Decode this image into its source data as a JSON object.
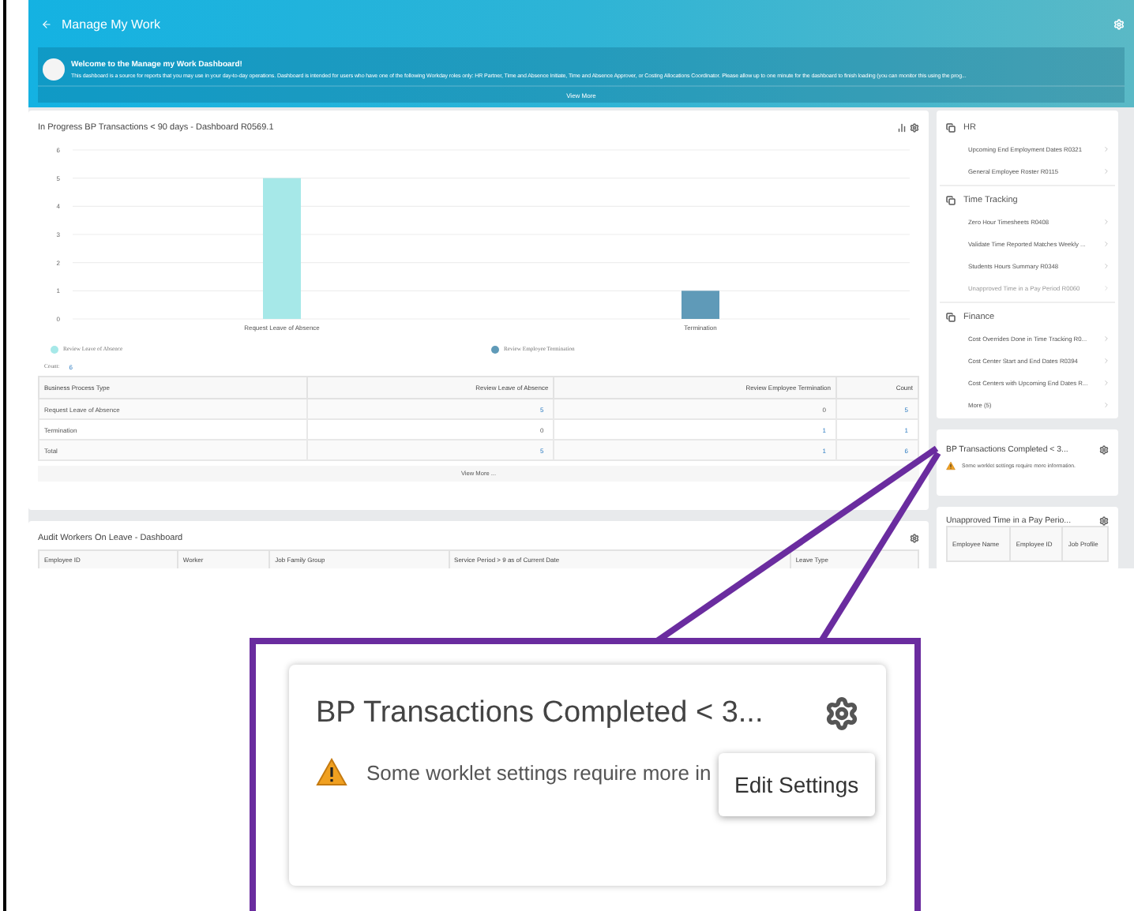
{
  "header": {
    "title": "Manage My Work"
  },
  "welcome": {
    "title": "Welcome to the Manage my Work Dashboard!",
    "text": "This dashboard is a source for reports that you may use in your day-to-day operations. Dashboard is intended for users who have one of the following Workday roles only: HR Partner, Time and Absence Initiate, Time and Absence Approver, or Costing Allocations Coordinator. Please allow up to one minute for the dashboard to finish loading (you can monitor this using the prog...",
    "action": "View More"
  },
  "chart_card": {
    "title": "In Progress BP Transactions < 90 days - Dashboard R0569.1",
    "chart_data": {
      "type": "bar",
      "categories": [
        "Request Leave of Absence",
        "Termination"
      ],
      "series": [
        {
          "name": "Review Leave of Absence",
          "color": "#a6e8e8",
          "values": [
            5,
            0
          ]
        },
        {
          "name": "Review Employee Termination",
          "color": "#5f9ab8",
          "values": [
            0,
            1
          ]
        }
      ],
      "ylim": [
        0,
        6
      ],
      "grid": true,
      "yticks": [
        0,
        1,
        2,
        3,
        4,
        5,
        6
      ]
    },
    "count_label": "Count:",
    "count": "6",
    "table": {
      "columns": [
        "Business Process Type",
        "Review Leave of Absence",
        "Review Employee Termination",
        "Count"
      ],
      "rows": [
        [
          {
            "text": "Request Leave of Absence",
            "link": false
          },
          {
            "text": "5",
            "link": true
          },
          {
            "text": "0",
            "link": false
          },
          {
            "text": "5",
            "link": true
          }
        ],
        [
          {
            "text": "Termination",
            "link": false
          },
          {
            "text": "0",
            "link": false
          },
          {
            "text": "1",
            "link": true
          },
          {
            "text": "1",
            "link": true
          }
        ],
        [
          {
            "text": "Total",
            "link": false
          },
          {
            "text": "5",
            "link": true
          },
          {
            "text": "1",
            "link": true
          },
          {
            "text": "6",
            "link": true
          }
        ]
      ]
    },
    "view_more": "View More ..."
  },
  "audit_card": {
    "title": "Audit Workers On Leave - Dashboard",
    "columns": [
      "Employee ID",
      "Worker",
      "Job Family Group",
      "Service Period > 9 as of Current Date",
      "Leave Type"
    ]
  },
  "nav": {
    "sections": [
      {
        "title": "HR",
        "items": [
          "Upcoming End Employment Dates R0321",
          "General Employee Roster R0115"
        ]
      },
      {
        "title": "Time Tracking",
        "items": [
          "Zero Hour Timesheets R0408",
          "Validate Time Reported Matches Weekly ...",
          "Students Hours Summary R0348",
          "Unapproved Time in a Pay Period R0060"
        ]
      },
      {
        "title": "Finance",
        "items": [
          "Cost Overrides Done in Time Tracking R0...",
          "Cost Center Start and End Dates R0394",
          "Cost Centers with Upcoming End Dates R...",
          "More (5)"
        ]
      }
    ]
  },
  "bp_card": {
    "title": "BP Transactions Completed < 3...",
    "message": "Some worklet settings require more information."
  },
  "unapproved_card": {
    "title": "Unapproved Time in a Pay Perio...",
    "columns": [
      "Employee Name",
      "Employee ID",
      "Job Profile"
    ]
  },
  "callout": {
    "title": "BP Transactions Completed < 3...",
    "message": "Some worklet settings require more in",
    "tooltip": "Edit Settings"
  }
}
